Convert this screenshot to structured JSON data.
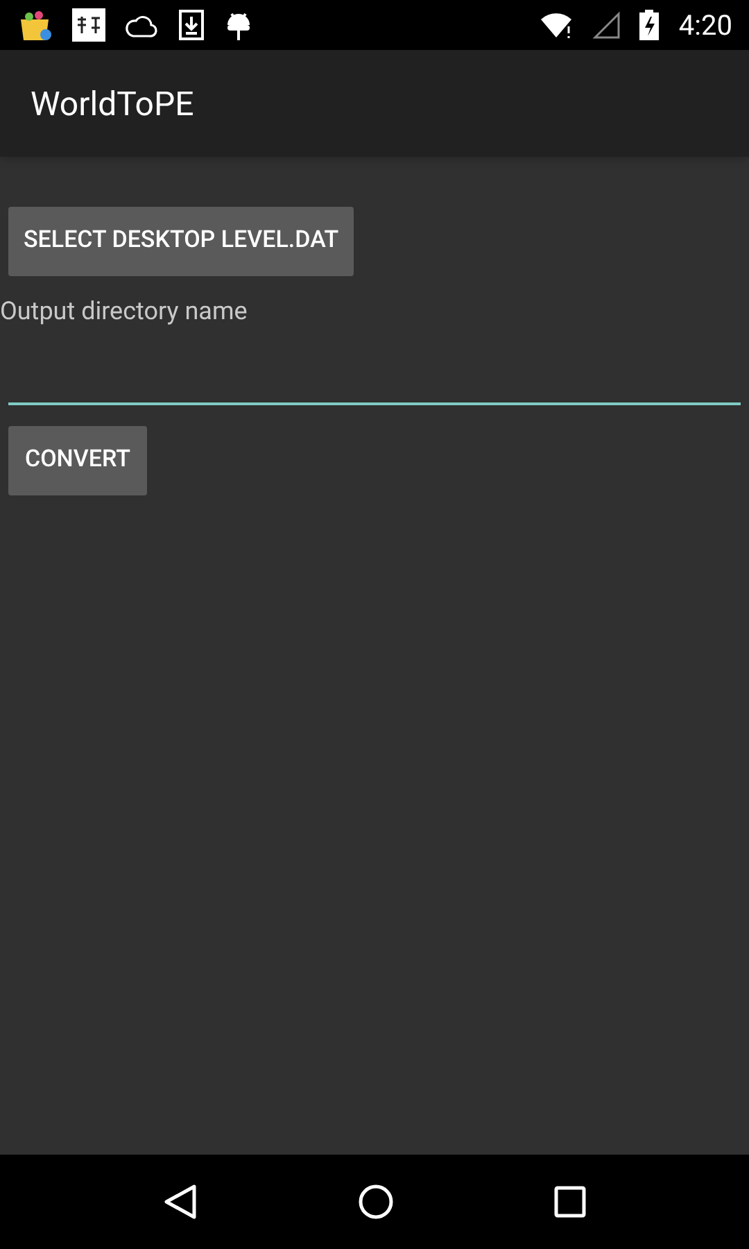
{
  "status_bar": {
    "time": "4:20"
  },
  "app_bar": {
    "title": "WorldToPE"
  },
  "buttons": [
    {
      "label": "SELECT DESKTOP LEVEL.DAT"
    }
  ],
  "output_field": {
    "label": "Output directory name"
  },
  "convert_button": {
    "label": "CONVERT"
  }
}
